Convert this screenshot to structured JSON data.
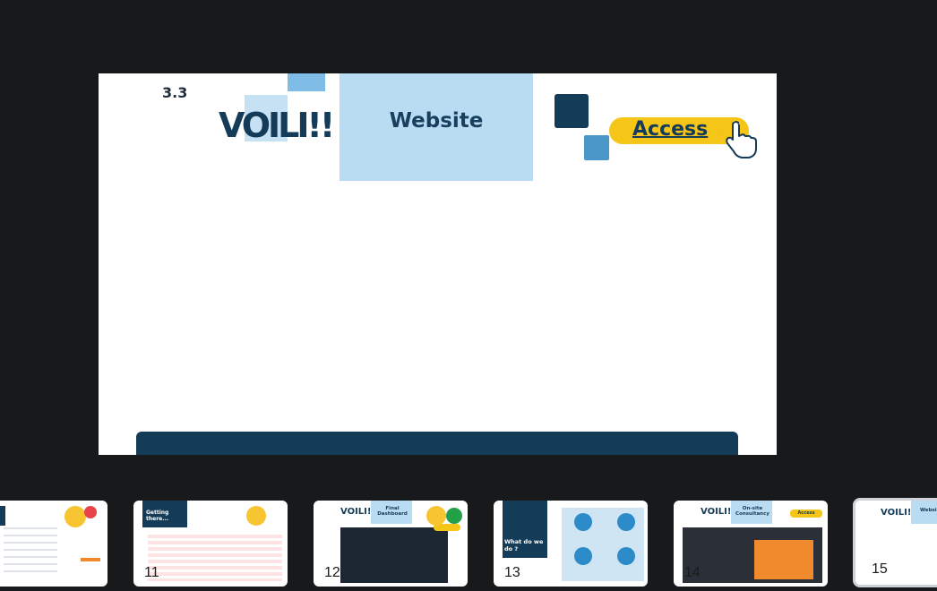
{
  "slide": {
    "section": "3.3",
    "logo": "VOILI!!",
    "title": "Website",
    "access_label": "Access"
  },
  "thumbnails": [
    {
      "num": "",
      "label": ""
    },
    {
      "num": "11",
      "label": "Getting there..."
    },
    {
      "num": "12",
      "logo": "VOILI!!",
      "label": "Final Dashboard",
      "access": "Access"
    },
    {
      "num": "13",
      "label": "What do we do ?"
    },
    {
      "num": "14",
      "logo": "VOILI!!",
      "label": "On-site Consultancy",
      "access": "Access"
    },
    {
      "num": "15",
      "logo": "VOILI!!",
      "label": "Websi"
    }
  ],
  "colors": {
    "navy": "#143b58",
    "light_blue": "#b9dcf2",
    "yellow": "#f5c518",
    "background": "#18191b"
  }
}
